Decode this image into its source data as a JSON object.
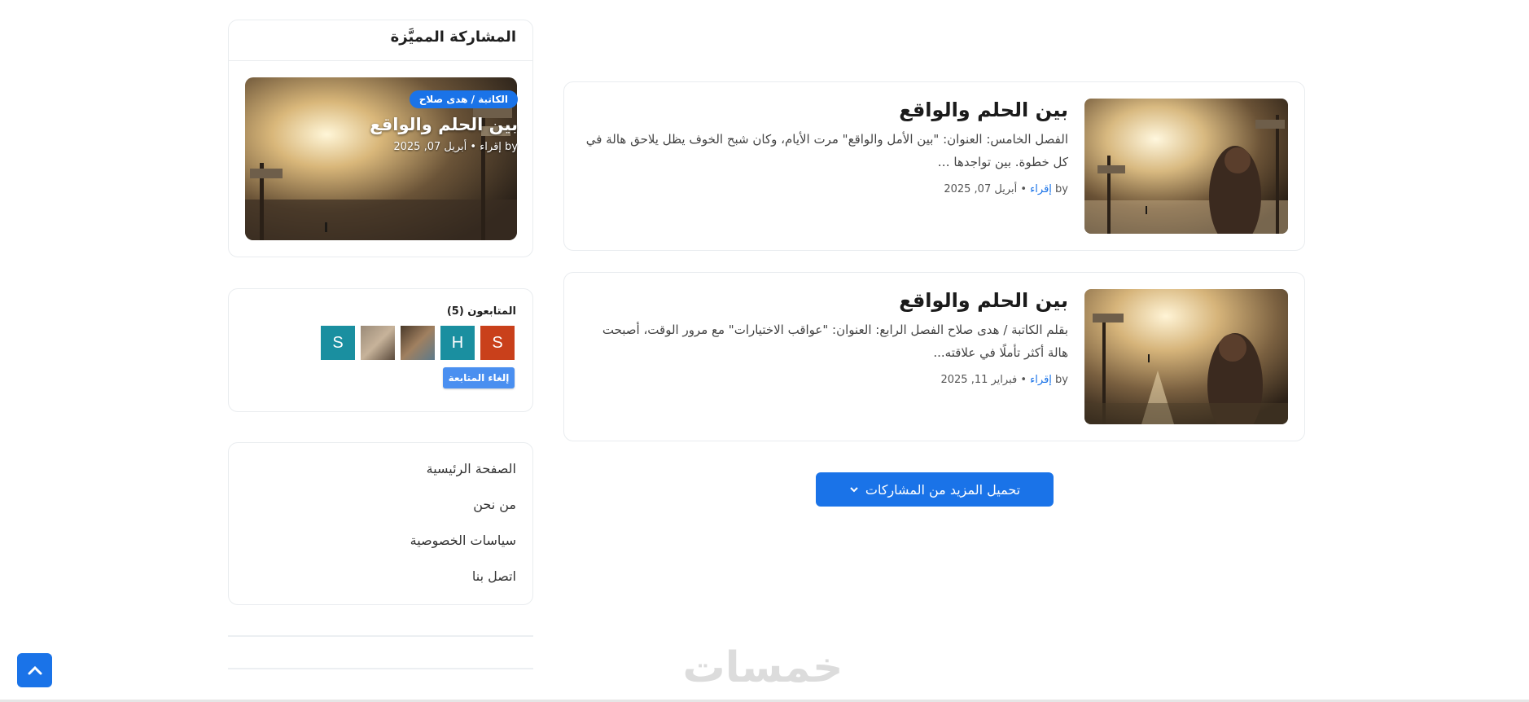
{
  "sidebar": {
    "featured": {
      "heading": "المشاركة المميَّزة",
      "badge": "الكاتبة / هدى صلاح",
      "title": "بين الحلم والواقع",
      "meta": "by إقراء • أبريل 07, 2025"
    },
    "followers": {
      "title": "المتابعون (5)",
      "avatars": [
        {
          "letter": "S",
          "color": "#c9401b"
        },
        {
          "letter": "H",
          "color": "#1a8fa0"
        },
        {
          "letter": "",
          "color": "#6b5a45"
        },
        {
          "letter": "",
          "color": "#8a7b6a"
        },
        {
          "letter": "S",
          "color": "#1a8fa0"
        }
      ],
      "unfollow_label": "إلغاء المتابعة"
    },
    "pages": [
      "الصفحة الرئيسية",
      "من نحن",
      "سياسات الخصوصية",
      "اتصل بنا"
    ]
  },
  "posts": [
    {
      "title": "بين الحلم والواقع",
      "snippet": "الفصل الخامس: العنوان: \"بين الأمل والواقع\" مرت الأيام، وكان شبح الخوف يظل يلاحق هالة في كل خطوة. بين تواجدها …",
      "by": "by",
      "author": "إقراء",
      "date": "• أبريل 07, 2025"
    },
    {
      "title": "بين الحلم والواقع",
      "snippet": "بقلم الكاتبة / هدى صلاح الفصل الرابع: العنوان: \"عواقب الاختيارات\" مع مرور الوقت، أصبحت هالة أكثر تأملًا في علاقته...",
      "by": "by",
      "author": "إقراء",
      "date": "• فبراير 11, 2025"
    }
  ],
  "load_more_label": "تحميل المزيد من المشاركات",
  "watermark": "خمسات",
  "colors": {
    "accent": "#1a73e8"
  }
}
